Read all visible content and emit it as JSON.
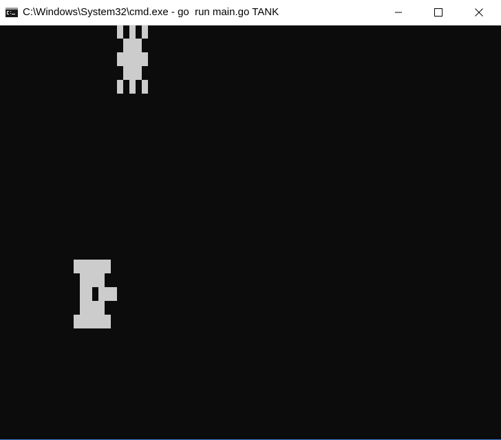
{
  "window": {
    "title": "C:\\Windows\\System32\\cmd.exe - go  run main.go TANK",
    "icon": "cmd-icon",
    "controls": {
      "minimize_icon": "minimize-icon",
      "maximize_icon": "maximize-icon",
      "close_icon": "close-icon"
    }
  },
  "colors": {
    "console_background": "#0c0c0c",
    "sprite": "#cccccc",
    "titlebar": "#ffffff"
  },
  "game": {
    "enemy_tank": {
      "facing": "down"
    },
    "player_tank": {
      "facing": "right"
    }
  }
}
